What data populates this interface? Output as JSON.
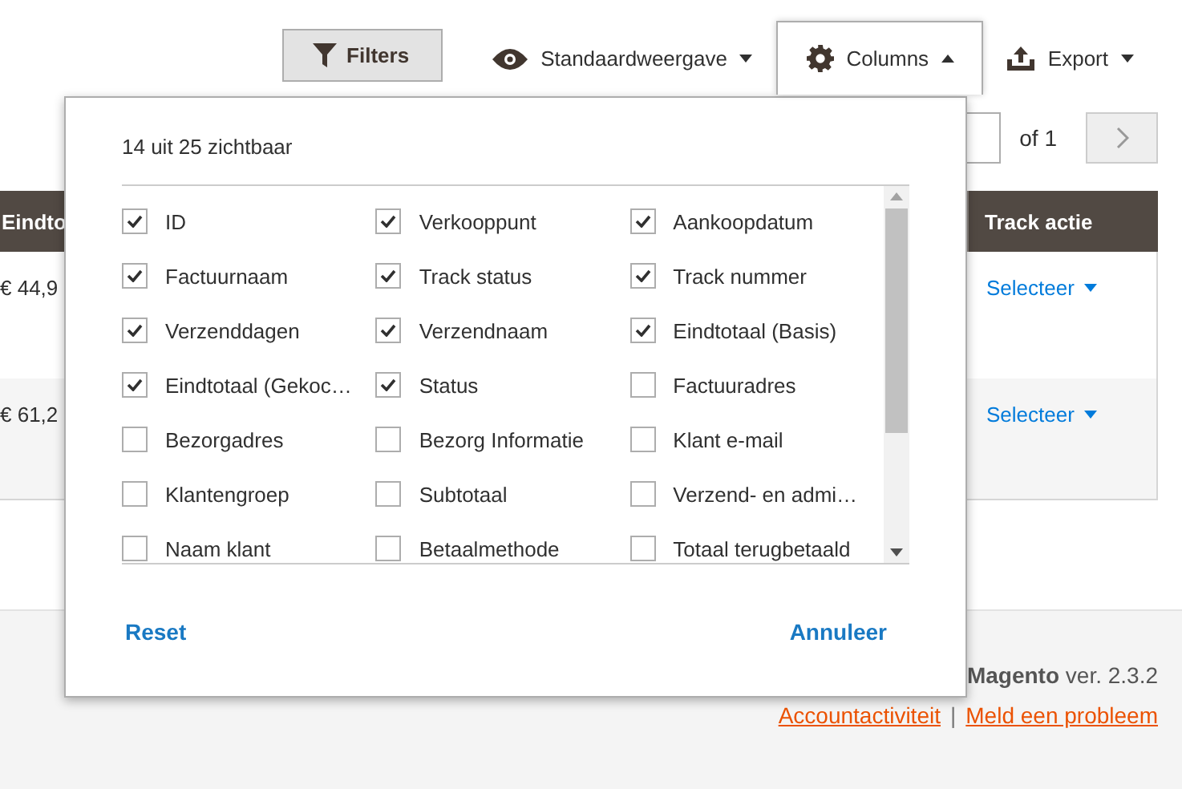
{
  "toolbar": {
    "filters": "Filters",
    "view": "Standaardweergave",
    "columns": {
      "label": "Columns",
      "expanded": true
    },
    "export": "Export"
  },
  "pagination": {
    "of": "of 1"
  },
  "table": {
    "header": [
      "Eindto",
      "Track actie"
    ],
    "rows": [
      {
        "amount": "€ 44,9",
        "action": "Selecteer"
      },
      {
        "amount": "€ 61,2",
        "action": "Selecteer"
      }
    ]
  },
  "columns_panel": {
    "summary": "14 uit 25 zichtbaar",
    "options": [
      {
        "label": "ID",
        "checked": true
      },
      {
        "label": "Verkooppunt",
        "checked": true
      },
      {
        "label": "Aankoopdatum",
        "checked": true
      },
      {
        "label": "Factuurnaam",
        "checked": true
      },
      {
        "label": "Track status",
        "checked": true
      },
      {
        "label": "Track nummer",
        "checked": true
      },
      {
        "label": "Verzenddagen",
        "checked": true
      },
      {
        "label": "Verzendnaam",
        "checked": true
      },
      {
        "label": "Eindtotaal (Basis)",
        "checked": true
      },
      {
        "label": "Eindtotaal (Gekoc…",
        "checked": true
      },
      {
        "label": "Status",
        "checked": true
      },
      {
        "label": "Factuuradres",
        "checked": false
      },
      {
        "label": "Bezorgadres",
        "checked": false
      },
      {
        "label": "Bezorg Informatie",
        "checked": false
      },
      {
        "label": "Klant e-mail",
        "checked": false
      },
      {
        "label": "Klantengroep",
        "checked": false
      },
      {
        "label": "Subtotaal",
        "checked": false
      },
      {
        "label": "Verzend- en admi…",
        "checked": false
      },
      {
        "label": "Naam klant",
        "checked": false
      },
      {
        "label": "Betaalmethode",
        "checked": false
      },
      {
        "label": "Totaal terugbetaald",
        "checked": false
      }
    ],
    "reset": "Reset",
    "cancel": "Annuleer"
  },
  "footer": {
    "version": "**Magento** ver. 2.3.2",
    "links": [
      "Accountactiviteit",
      "Meld een probleem"
    ],
    "separator": "|"
  }
}
